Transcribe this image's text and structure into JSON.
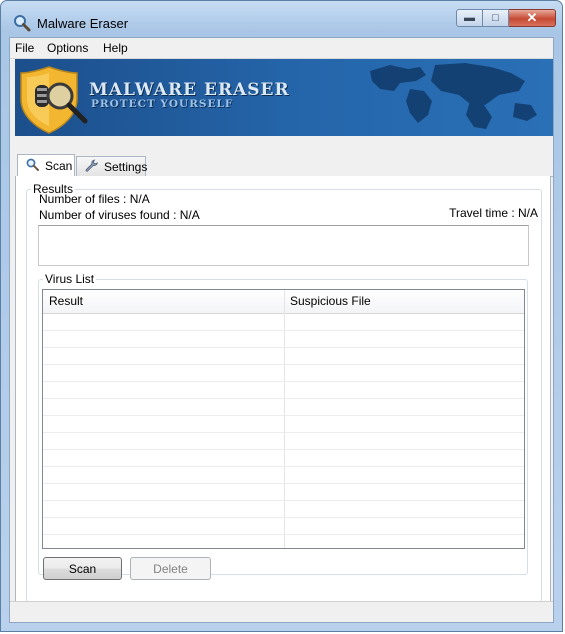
{
  "window": {
    "title": "Malware Eraser",
    "controls": {
      "minimize": "▬",
      "maximize": "□",
      "close": "✕"
    }
  },
  "menu": [
    "File",
    "Options",
    "Help"
  ],
  "banner": {
    "title": "MALWARE ERASER",
    "subtitle": "PROTECT YOURSELF"
  },
  "tabs": [
    {
      "label": "Scan",
      "icon": "magnifier-icon",
      "active": true
    },
    {
      "label": "Settings",
      "icon": "wrench-icon",
      "active": false
    }
  ],
  "results": {
    "legend": "Results",
    "files_count": "Number of files : N/A",
    "viruses_found": "Number of viruses found : N/A",
    "travel_time": "Travel time : N/A"
  },
  "virus_list": {
    "legend": "Virus List",
    "columns": [
      "Result",
      "Suspicious File"
    ],
    "rows": []
  },
  "buttons": {
    "scan": "Scan",
    "delete": "Delete"
  },
  "colors": {
    "banner": "#1c4f8c",
    "accent": "#2566ab"
  }
}
